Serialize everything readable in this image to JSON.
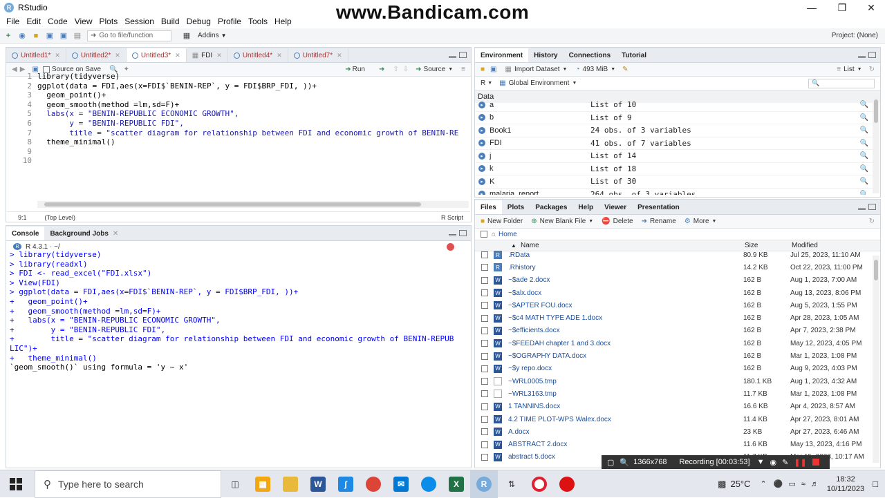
{
  "window": {
    "title": "RStudio",
    "watermark": "www.Bandicam.com"
  },
  "menu": [
    "File",
    "Edit",
    "Code",
    "View",
    "Plots",
    "Session",
    "Build",
    "Debug",
    "Profile",
    "Tools",
    "Help"
  ],
  "toolbar": {
    "goto_placeholder": "Go to file/function",
    "addins": "Addins",
    "project": "Project: (None)"
  },
  "editor": {
    "tabs": [
      "Untitled1*",
      "Untitled2*",
      "Untitled3*",
      "FDI",
      "Untitled4*",
      "Untitled7*"
    ],
    "active_tab": 2,
    "source_on_save": "Source on Save",
    "run_label": "Run",
    "source_label": "Source",
    "lines": [
      "library(tidyverse)",
      "ggplot(data = FDI,aes(x=FDI$`BENIN-REP`, y = FDI$BRP_FDI, ))+",
      "  geom_point()+",
      "  geom_smooth(method =lm,sd=F)+",
      "  labs(x = \"BENIN-REPUBLIC ECONOMIC GROWTH\",",
      "       y = \"BENIN-REPUBLIC FDI\",",
      "       title = \"scatter diagram for relationship between FDI and economic growth of BENIN-RE",
      "  theme_minimal()",
      "",
      ""
    ],
    "line_numbers": [
      "1",
      "2",
      "3",
      "4",
      "5",
      "6",
      "7",
      "8",
      "9",
      "10"
    ],
    "status_pos": "9:1",
    "status_level": "(Top Level)",
    "status_type": "R Script"
  },
  "console": {
    "tabs": [
      "Console",
      "Background Jobs"
    ],
    "r_version": "R 4.3.1 · ~/",
    "lines": [
      {
        "t": "> library(tidyverse)",
        "k": "in"
      },
      {
        "t": "> library(readxl)",
        "k": "in"
      },
      {
        "t": "> FDI <- read_excel(\"FDI.xlsx\")",
        "k": "in"
      },
      {
        "t": "> View(FDI)",
        "k": "in"
      },
      {
        "t": "> ggplot(data = FDI,aes(x=FDI$`BENIN-REP`, y = FDI$BRP_FDI, ))+",
        "k": "in"
      },
      {
        "t": "+   geom_point()+",
        "k": "in"
      },
      {
        "t": "+   geom_smooth(method =lm,sd=F)+",
        "k": "in"
      },
      {
        "t": "+   labs(x = \"BENIN-REPUBLIC ECONOMIC GROWTH\",",
        "k": "in"
      },
      {
        "t": "+        y = \"BENIN-REPUBLIC FDI\",",
        "k": "in"
      },
      {
        "t": "+        title = \"scatter diagram for relationship between FDI and economic growth of BENIN-REPUB",
        "k": "in"
      },
      {
        "t": "LIC\")+",
        "k": "in"
      },
      {
        "t": "+   theme_minimal()",
        "k": "in"
      },
      {
        "t": "`geom_smooth()` using formula = 'y ~ x'",
        "k": "out"
      }
    ]
  },
  "environment": {
    "tabs": [
      "Environment",
      "History",
      "Connections",
      "Tutorial"
    ],
    "import_label": "Import Dataset",
    "memory": "493 MiB",
    "list_label": "List",
    "scope": "Global Environment",
    "lang": "R",
    "section": "Data",
    "rows": [
      {
        "name": "a",
        "value": "List of  10"
      },
      {
        "name": "b",
        "value": "List of  9"
      },
      {
        "name": "Book1",
        "value": "24 obs. of 3 variables"
      },
      {
        "name": "FDI",
        "value": "41 obs. of 7 variables"
      },
      {
        "name": "j",
        "value": "List of  14"
      },
      {
        "name": "k",
        "value": "List of  18"
      },
      {
        "name": "K",
        "value": "List of  30"
      },
      {
        "name": "malaria_report",
        "value": "264 obs. of 3 variables"
      }
    ]
  },
  "files": {
    "tabs": [
      "Files",
      "Plots",
      "Packages",
      "Help",
      "Viewer",
      "Presentation"
    ],
    "new_folder": "New Folder",
    "new_blank": "New Blank File",
    "delete": "Delete",
    "rename": "Rename",
    "more": "More",
    "home": "Home",
    "headers": {
      "name": "Name",
      "size": "Size",
      "modified": "Modified"
    },
    "rows": [
      {
        "name": ".RData",
        "size": "80.9 KB",
        "mod": "Jul 25, 2023, 11:10 AM",
        "icon": "r-data-icon"
      },
      {
        "name": ".Rhistory",
        "size": "14.2 KB",
        "mod": "Oct 22, 2023, 11:00 PM",
        "icon": "r-history-icon"
      },
      {
        "name": "~$ade 2.docx",
        "size": "162 B",
        "mod": "Aug 1, 2023, 7:00 AM",
        "icon": "word-icon"
      },
      {
        "name": "~$alx.docx",
        "size": "162 B",
        "mod": "Aug 13, 2023, 8:06 PM",
        "icon": "word-icon"
      },
      {
        "name": "~$APTER FOU.docx",
        "size": "162 B",
        "mod": "Aug 5, 2023, 1:55 PM",
        "icon": "word-icon"
      },
      {
        "name": "~$c4 MATH TYPE ADE 1.docx",
        "size": "162 B",
        "mod": "Apr 28, 2023, 1:05 AM",
        "icon": "word-icon"
      },
      {
        "name": "~$efficients.docx",
        "size": "162 B",
        "mod": "Apr 7, 2023, 2:38 PM",
        "icon": "word-icon"
      },
      {
        "name": "~$FEEDAH chapter 1 and 3.docx",
        "size": "162 B",
        "mod": "May 12, 2023, 4:05 PM",
        "icon": "word-icon"
      },
      {
        "name": "~$OGRAPHY DATA.docx",
        "size": "162 B",
        "mod": "Mar 1, 2023, 1:08 PM",
        "icon": "word-icon"
      },
      {
        "name": "~$y repo.docx",
        "size": "162 B",
        "mod": "Aug 9, 2023, 4:03 PM",
        "icon": "word-icon"
      },
      {
        "name": "~WRL0005.tmp",
        "size": "180.1 KB",
        "mod": "Aug 1, 2023, 4:32 AM",
        "icon": "file-icon"
      },
      {
        "name": "~WRL3163.tmp",
        "size": "11.7 KB",
        "mod": "Mar 1, 2023, 1:08 PM",
        "icon": "file-icon"
      },
      {
        "name": "1 TANNINS.docx",
        "size": "16.6 KB",
        "mod": "Apr 4, 2023, 8:57 AM",
        "icon": "word-icon"
      },
      {
        "name": "4.2 TIME PLOT-WPS Walex.docx",
        "size": "11.4 KB",
        "mod": "Apr 27, 2023, 8:01 AM",
        "icon": "word-icon"
      },
      {
        "name": "A.docx",
        "size": "23 KB",
        "mod": "Apr 27, 2023, 6:46 AM",
        "icon": "word-icon"
      },
      {
        "name": "ABSTRACT 2.docx",
        "size": "11.6 KB",
        "mod": "May 13, 2023, 4:16 PM",
        "icon": "word-icon"
      },
      {
        "name": "abstract 5.docx",
        "size": "11.7 KB",
        "mod": "Mar 15, 2023, 10:17 AM",
        "icon": "word-icon"
      }
    ]
  },
  "recording": {
    "resolution": "1366x768",
    "status": "Recording [00:03:53]"
  },
  "taskbar": {
    "search_placeholder": "Type here to search",
    "temperature": "25°C",
    "time": "18:32",
    "date": "10/11/2023"
  },
  "colors": {
    "accent": "#4a7ebb",
    "tab_bar": "#e8ecf0",
    "taskbar": "#e4e8ee"
  }
}
